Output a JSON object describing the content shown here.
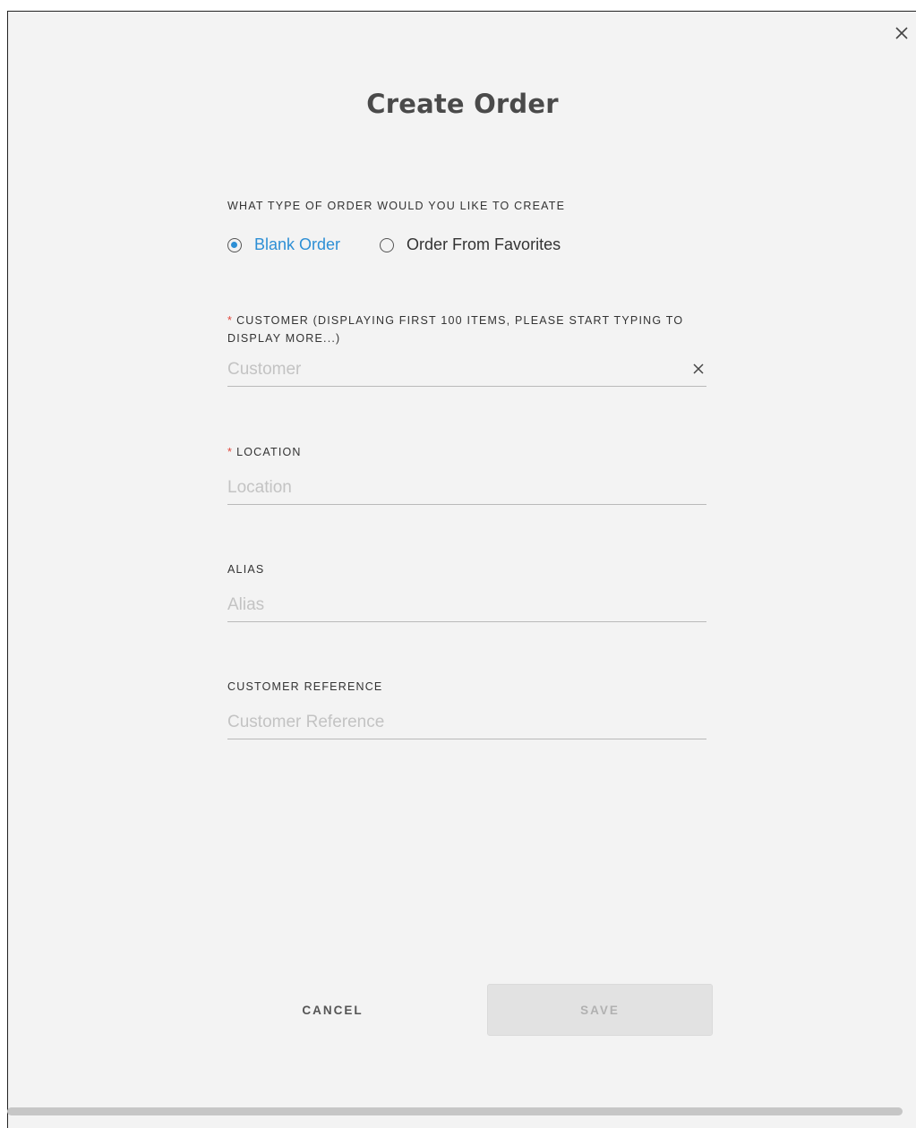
{
  "title": "Create Order",
  "order_type": {
    "label": "WHAT TYPE OF ORDER WOULD YOU LIKE TO CREATE",
    "options": [
      {
        "label": "Blank Order",
        "selected": true
      },
      {
        "label": "Order From Favorites",
        "selected": false
      }
    ]
  },
  "customer": {
    "required_mark": "*",
    "label": "CUSTOMER (DISPLAYING FIRST 100 ITEMS, PLEASE START TYPING TO DISPLAY MORE...)",
    "placeholder": "Customer",
    "value": ""
  },
  "location": {
    "required_mark": "*",
    "label": "LOCATION",
    "placeholder": "Location",
    "value": ""
  },
  "alias": {
    "label": "ALIAS",
    "placeholder": "Alias",
    "value": ""
  },
  "customer_reference": {
    "label": "CUSTOMER REFERENCE",
    "placeholder": "Customer Reference",
    "value": ""
  },
  "buttons": {
    "cancel": "CANCEL",
    "save": "SAVE"
  },
  "colors": {
    "accent": "#2d8fd5",
    "required": "#e0453a",
    "background": "#f3f3f3",
    "disabled_button": "#e2e2e2"
  },
  "icons": {
    "close": "close-icon",
    "clear": "clear-icon"
  }
}
